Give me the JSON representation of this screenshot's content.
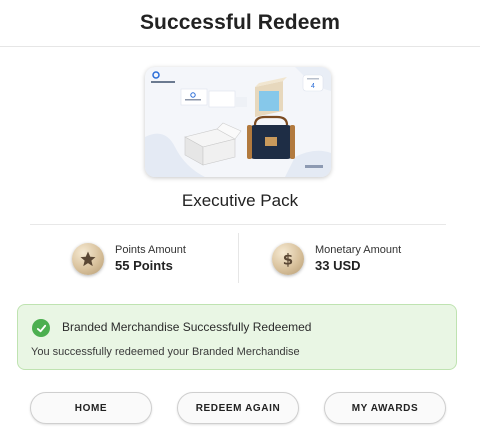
{
  "header": {
    "title": "Successful Redeem"
  },
  "product": {
    "name": "Executive Pack",
    "image": {
      "brand_text": "SAMPLE BRAND",
      "badge_number": "4"
    }
  },
  "stats": {
    "points": {
      "label": "Points Amount",
      "value": "55 Points",
      "icon": "star-coin-icon"
    },
    "monetary": {
      "label": "Monetary Amount",
      "value": "33 USD",
      "icon": "dollar-coin-icon"
    }
  },
  "alert": {
    "title": "Branded Merchandise Successfully Redeemed",
    "message": "You successfully redeemed your Branded Merchandise",
    "icon": "check-circle-icon",
    "color": "#4caf50"
  },
  "actions": {
    "home": "HOME",
    "redeem_again": "REDEEM AGAIN",
    "my_awards": "MY AWARDS"
  }
}
